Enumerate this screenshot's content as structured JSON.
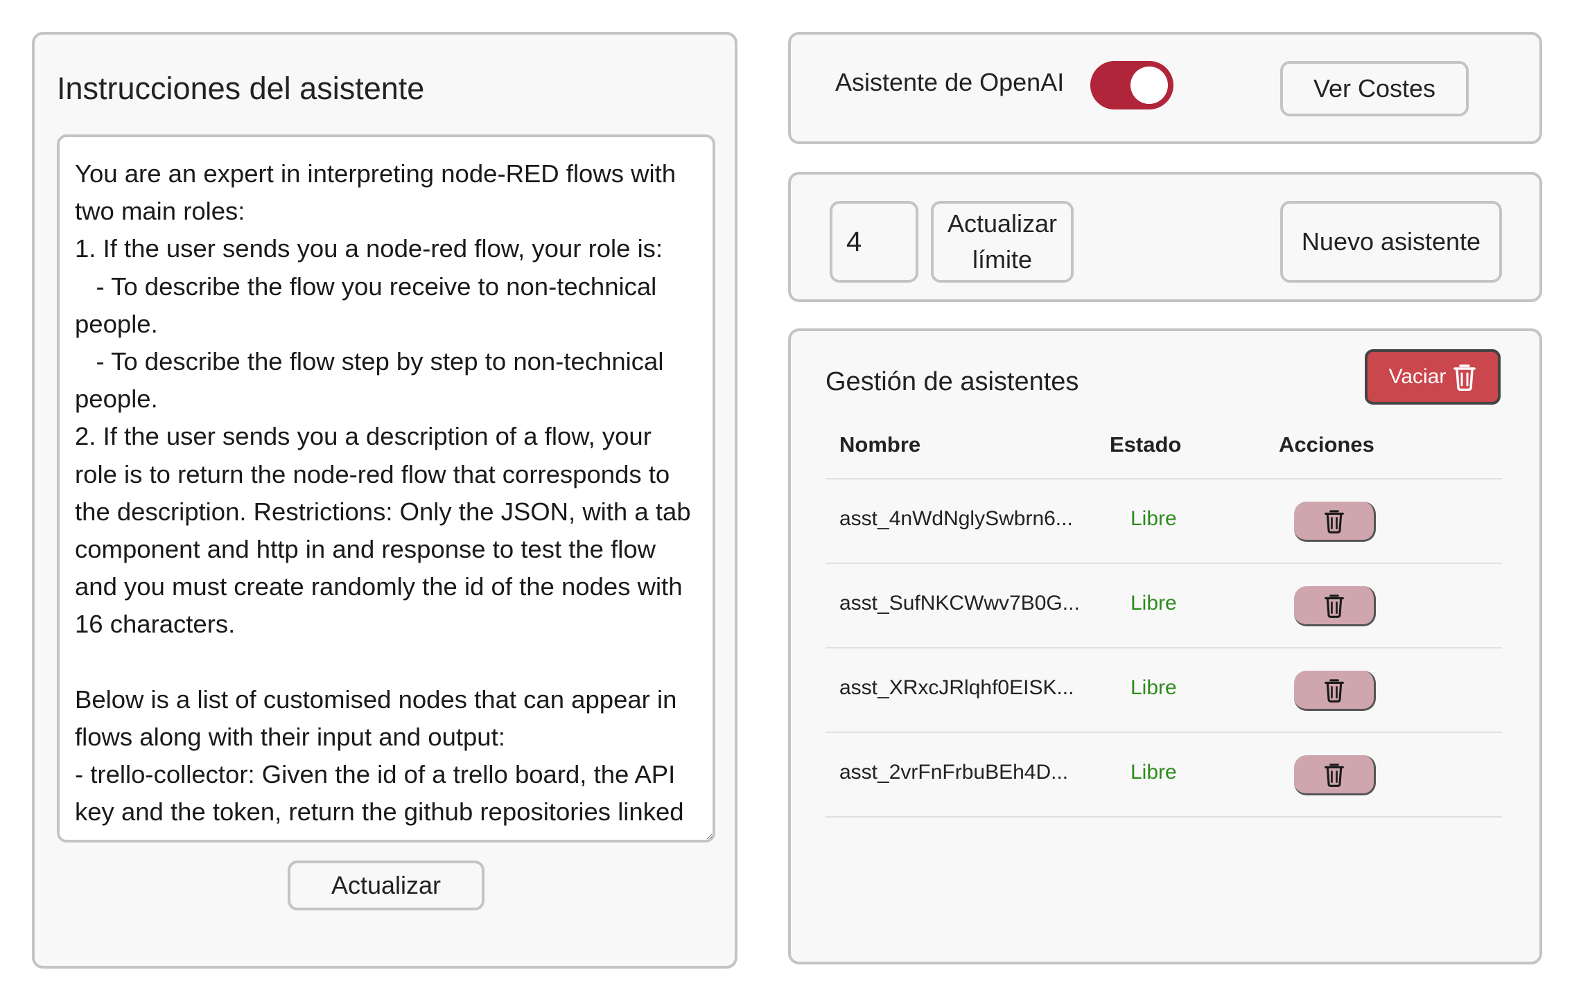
{
  "instructions": {
    "title": "Instrucciones del asistente",
    "text": "You are an expert in interpreting node-RED flows with two main roles:\n1. If the user sends you a node-red flow, your role is:\n   - To describe the flow you receive to non-technical people.\n   - To describe the flow step by step to non-technical people.\n2. If the user sends you a description of a flow, your role is to return the node-red flow that corresponds to the description. Restrictions: Only the JSON, with a tab component and http in and response to test the flow and you must create randomly the id of the nodes with 16 characters.\n\nBelow is a list of customised nodes that can appear in flows along with their input and output:\n- trello-collector: Given the id of a trello board, the API key and the token, return the github repositories linked to each existing card",
    "update_label": "Actualizar"
  },
  "assistant_toggle": {
    "label": "Asistente de OpenAI",
    "enabled": true,
    "view_costs_label": "Ver Costes"
  },
  "limit": {
    "value": "4",
    "update_limit_label": "Actualizar\nlímite",
    "new_assistant_label": "Nuevo asistente"
  },
  "management": {
    "title": "Gestión de asistentes",
    "empty_label": "Vaciar",
    "columns": {
      "name": "Nombre",
      "state": "Estado",
      "actions": "Acciones"
    },
    "rows": [
      {
        "name": "asst_4nWdNglySwbrn6...",
        "state": "Libre"
      },
      {
        "name": "asst_SufNKCWwv7B0G...",
        "state": "Libre"
      },
      {
        "name": "asst_XRxcJRlqhf0EISK...",
        "state": "Libre"
      },
      {
        "name": "asst_2vrFnFrbuBEh4D...",
        "state": "Libre"
      }
    ]
  },
  "icons": {
    "empty_icon": "trash-icon",
    "row_delete_icon": "trash-icon"
  },
  "colors": {
    "toggle_on": "#b0253a",
    "empty_button": "#c9474d",
    "delete_button": "#cfa6ad",
    "state_free": "#2e8b1e",
    "panel_border": "#c4c4c4"
  }
}
